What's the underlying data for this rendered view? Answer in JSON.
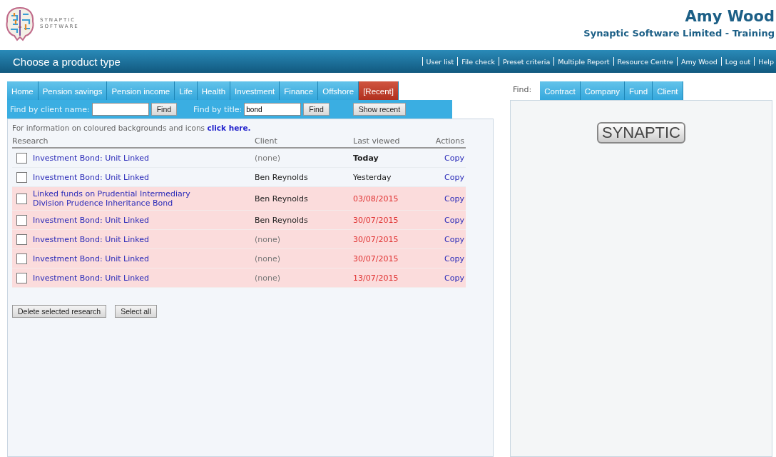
{
  "header": {
    "logo_line_1": "SYNAPTIC",
    "logo_line_2": "SOFTWARE",
    "user_name": "Amy Wood",
    "organisation": "Synaptic Software Limited - Training"
  },
  "nav_bar": {
    "title": "Choose a product type",
    "links": [
      "User list",
      "File check",
      "Preset criteria",
      "Multiple Report",
      "Resource Centre",
      "Amy Wood",
      "Log out",
      "Help"
    ]
  },
  "product_tabs": [
    {
      "label": "Home",
      "selected": false
    },
    {
      "label": "Pension savings",
      "selected": false
    },
    {
      "label": "Pension income",
      "selected": false
    },
    {
      "label": "Life",
      "selected": false
    },
    {
      "label": "Health",
      "selected": false
    },
    {
      "label": "Investment",
      "selected": false
    },
    {
      "label": "Finance",
      "selected": false
    },
    {
      "label": "Offshore",
      "selected": false
    },
    {
      "label": "[Recent]",
      "selected": true
    }
  ],
  "search_bar": {
    "client_label": "Find by client name:",
    "client_button": "Find",
    "title_label": "Find by title:",
    "title_value": "bond",
    "title_button": "Find",
    "recent_button": "Show recent"
  },
  "info": {
    "text": "For information on coloured backgrounds and icons",
    "link": "click here."
  },
  "table": {
    "columns": [
      "Research",
      "Client",
      "Last viewed",
      "Actions"
    ],
    "rows": [
      {
        "research": "Investment Bond: Unit Linked",
        "client": "(none)",
        "last_viewed": "Today",
        "action": "Copy",
        "checked": false,
        "stale": false,
        "client_set": false,
        "date_bold": true
      },
      {
        "research": "Investment Bond: Unit Linked",
        "client": "Ben Reynolds",
        "last_viewed": "Yesterday",
        "action": "Copy",
        "checked": false,
        "stale": false,
        "client_set": true,
        "date_bold": false
      },
      {
        "research": "Linked funds on Prudential Intermediary Division Prudence Inheritance Bond",
        "client": "Ben Reynolds",
        "last_viewed": "03/08/2015",
        "action": "Copy",
        "checked": false,
        "stale": true,
        "client_set": true,
        "date_bold": false
      },
      {
        "research": "Investment Bond: Unit Linked",
        "client": "Ben Reynolds",
        "last_viewed": "30/07/2015",
        "action": "Copy",
        "checked": false,
        "stale": true,
        "client_set": true,
        "date_bold": false
      },
      {
        "research": "Investment Bond: Unit Linked",
        "client": "(none)",
        "last_viewed": "30/07/2015",
        "action": "Copy",
        "checked": false,
        "stale": true,
        "client_set": false,
        "date_bold": false
      },
      {
        "research": "Investment Bond: Unit Linked",
        "client": "(none)",
        "last_viewed": "30/07/2015",
        "action": "Copy",
        "checked": false,
        "stale": true,
        "client_set": false,
        "date_bold": false
      },
      {
        "research": "Investment Bond: Unit Linked",
        "client": "(none)",
        "last_viewed": "13/07/2015",
        "action": "Copy",
        "checked": false,
        "stale": true,
        "client_set": false,
        "date_bold": false
      }
    ]
  },
  "table_buttons": [
    "Delete selected research",
    "Select all"
  ],
  "find_panel": {
    "label": "Find:",
    "tabs": [
      {
        "label": "Contract",
        "selected": false
      },
      {
        "label": "Company",
        "selected": false
      },
      {
        "label": "Fund",
        "selected": false
      },
      {
        "label": "Client",
        "selected": false
      }
    ],
    "badge": "SYNAPTIC"
  }
}
